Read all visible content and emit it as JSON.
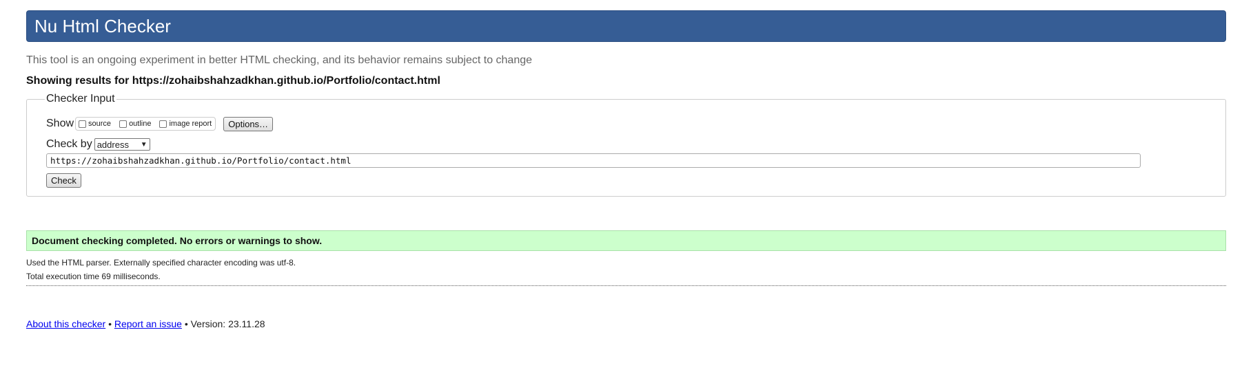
{
  "header": {
    "title": "Nu Html Checker"
  },
  "subtitle": "This tool is an ongoing experiment in better HTML checking, and its behavior remains subject to change",
  "showing": "Showing results for https://zohaibshahzadkhan.github.io/Portfolio/contact.html",
  "checker": {
    "legend": "Checker Input",
    "show_label": "Show",
    "show_options": [
      {
        "label": "source",
        "checked": false
      },
      {
        "label": "outline",
        "checked": false
      },
      {
        "label": "image report",
        "checked": false
      }
    ],
    "options_button": "Options…",
    "check_by_label": "Check by",
    "check_by_selected": "address",
    "url_value": "https://zohaibshahzadkhan.github.io/Portfolio/contact.html",
    "check_button": "Check"
  },
  "result": {
    "message": "Document checking completed. No errors or warnings to show.",
    "colors": {
      "background": "#ccffcc"
    }
  },
  "details": {
    "parser": "Used the HTML parser. Externally specified character encoding was utf-8.",
    "time": "Total execution time 69 milliseconds."
  },
  "footer": {
    "about_link": "About this checker",
    "separator": "•",
    "report_link": "Report an issue",
    "version": "Version: 23.11.28"
  },
  "colors": {
    "header_bg": "#365d95",
    "link": "#0000ee"
  }
}
